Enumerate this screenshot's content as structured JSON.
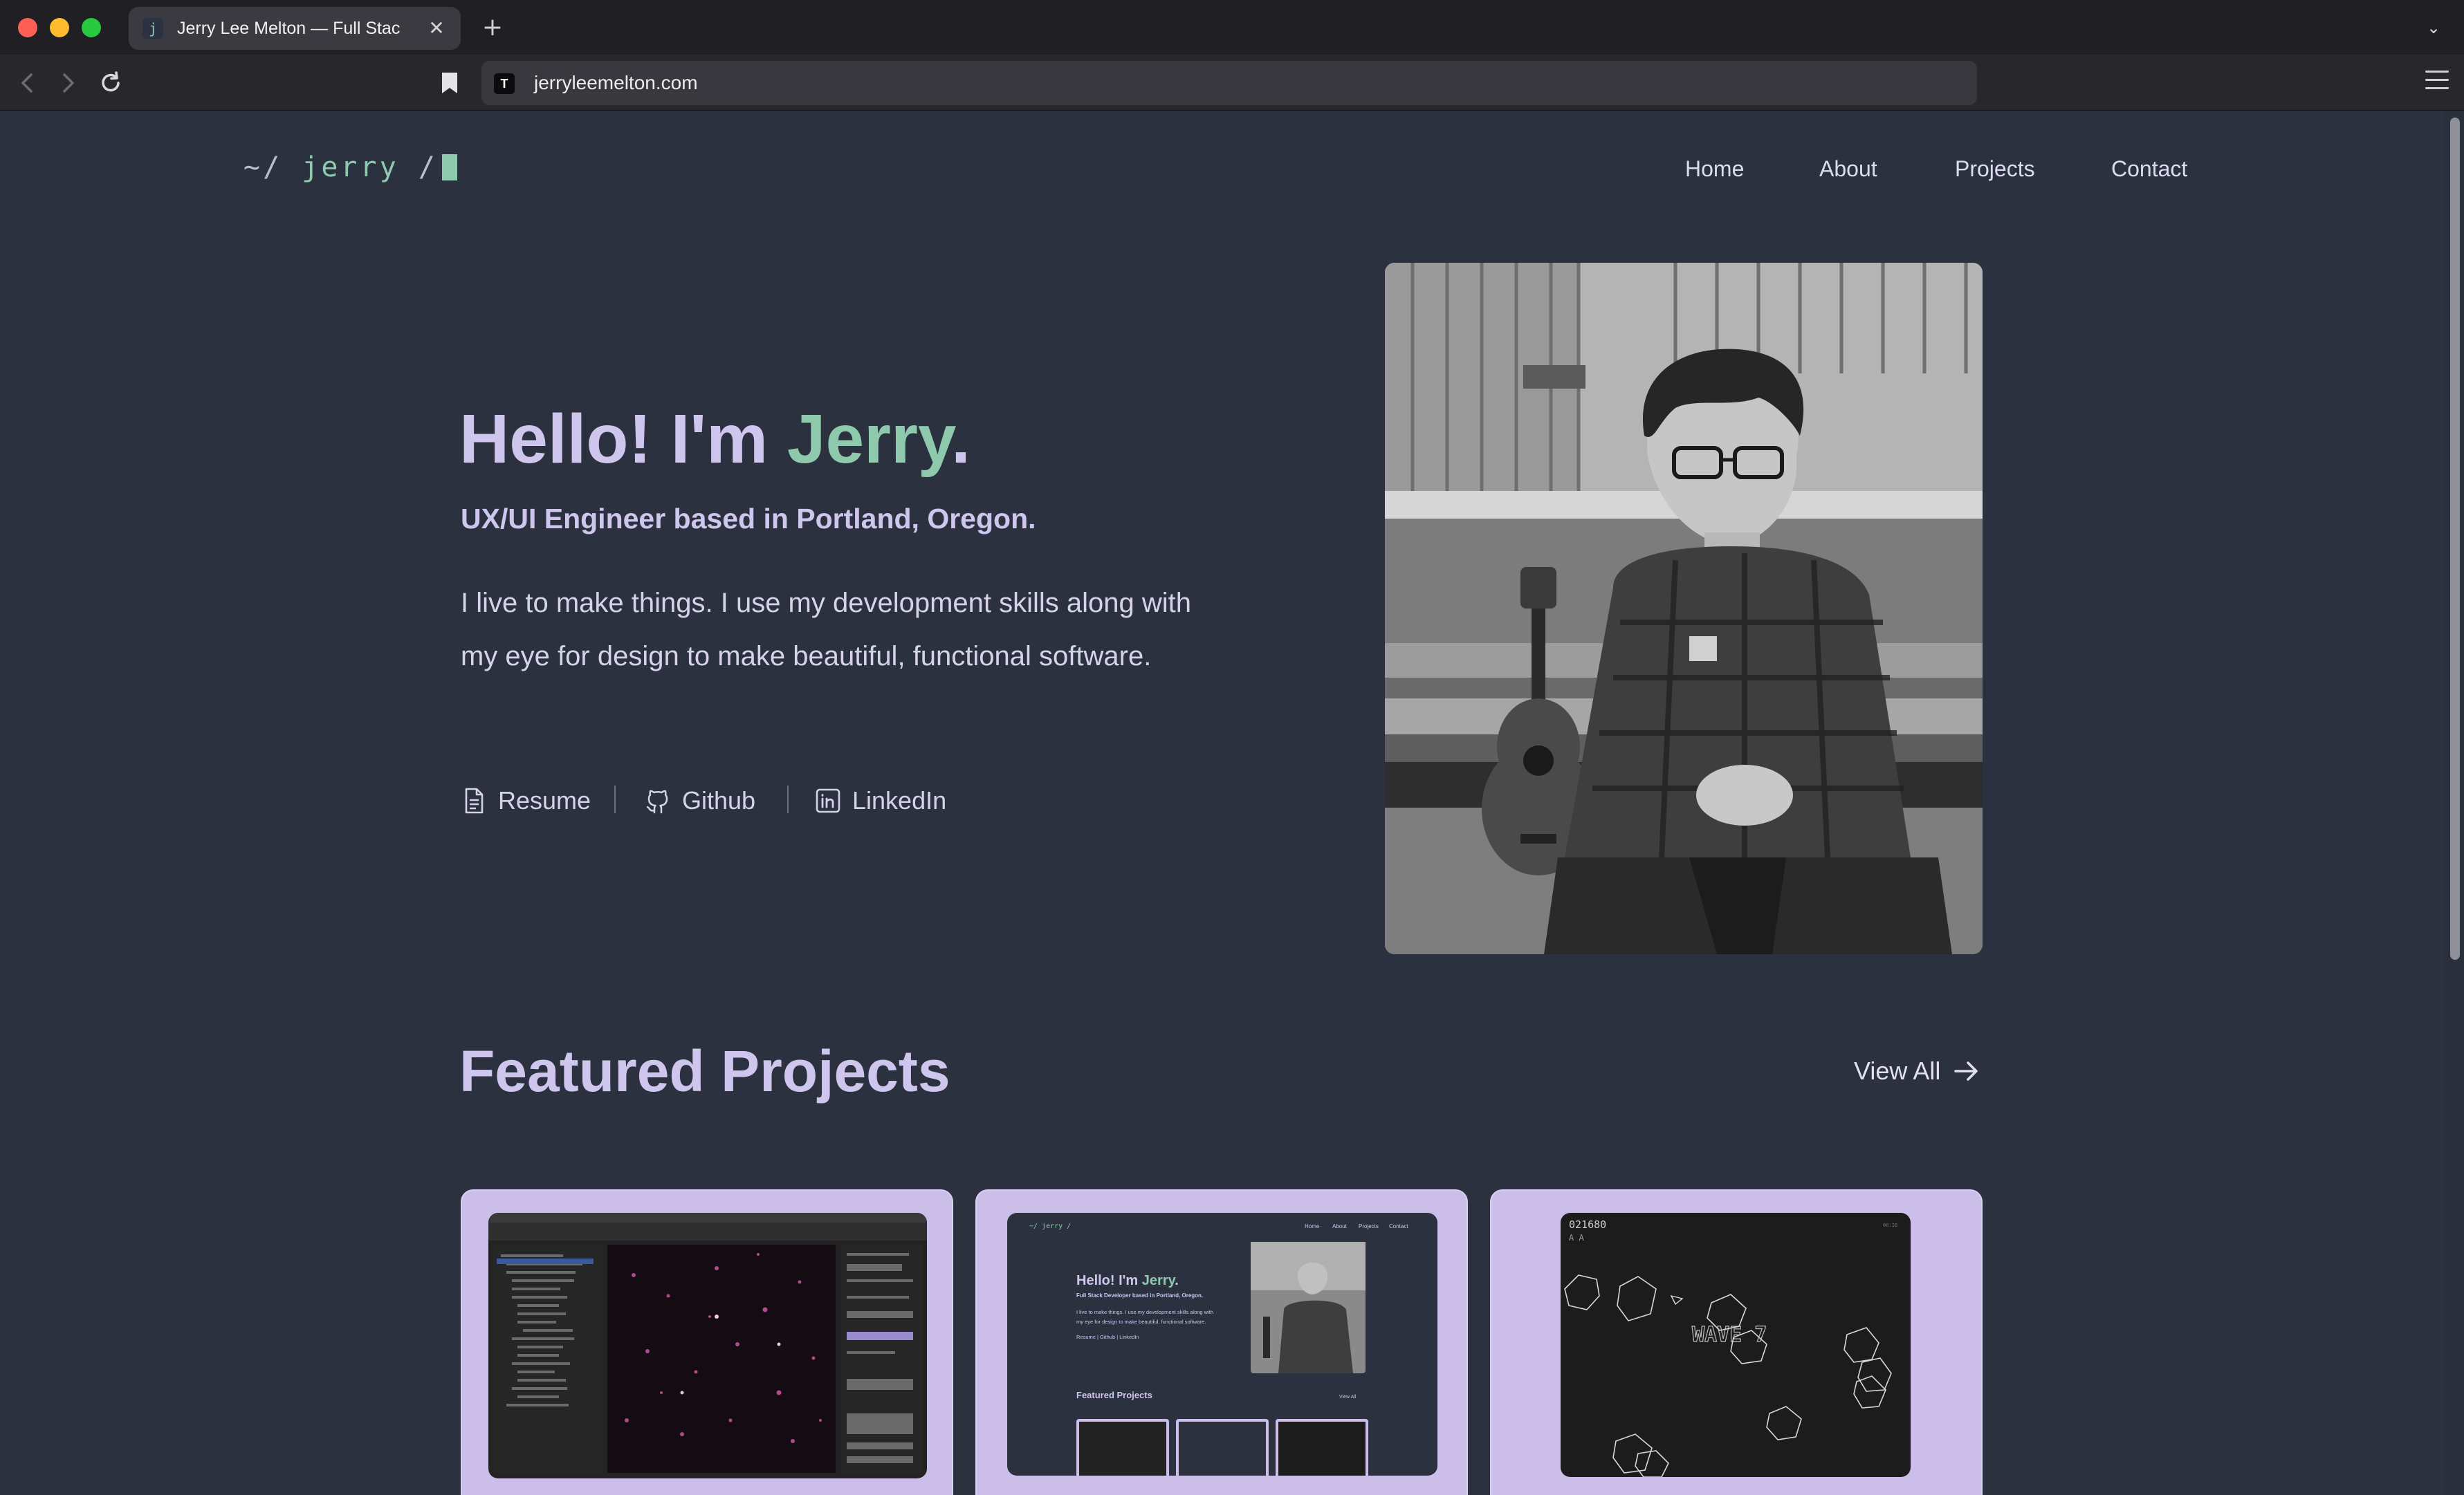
{
  "browser": {
    "tab_favicon": "j",
    "tab_title": "Jerry Lee Melton — Full Stack",
    "tab_close": "✕",
    "new_tab": "+",
    "tab_menu": "⌄",
    "url_favicon": "T",
    "url": "jerryleemelton.com"
  },
  "site": {
    "logo_prefix": "~/ ",
    "logo_name": "jerry",
    "logo_suffix": " /",
    "nav": [
      "Home",
      "About",
      "Projects",
      "Contact"
    ]
  },
  "hero": {
    "title_prefix": "Hello! I'm ",
    "title_name": "Jerry",
    "title_suffix": ".",
    "subtitle": "UX/UI Engineer based in Portland, Oregon.",
    "body": "I live to make things. I use my development skills along with my eye for design to make beautiful, functional software.",
    "links": [
      {
        "label": "Resume",
        "icon": "document-icon"
      },
      {
        "label": "Github",
        "icon": "github-icon"
      },
      {
        "label": "LinkedIn",
        "icon": "linkedin-icon"
      }
    ]
  },
  "featured": {
    "title": "Featured Projects",
    "view_all": "View All",
    "card2": {
      "logo": "~/ jerry /",
      "nav": [
        "Home",
        "About",
        "Projects",
        "Contact"
      ],
      "title_prefix": "Hello! I'm ",
      "title_name": "Jerry",
      "title_suffix": ".",
      "subtitle": "Full Stack Developer based in Portland, Oregon.",
      "body_line1": "I live to make things. I use my development skills along with",
      "body_line2": "my eye for design to make beautiful, functional software.",
      "links": "Resume  |  Github  |  LinkedIn",
      "section": "Featured Projects",
      "view_all": "View All"
    },
    "card3": {
      "score": "021680",
      "lives": "A A",
      "wave": "WAVE 7",
      "hint": "00:18"
    }
  },
  "colors": {
    "page_bg": "#2c3140",
    "accent_green": "#8ec9ae",
    "lavender": "#cfc6ee",
    "card_bg": "#cbbfe9"
  }
}
